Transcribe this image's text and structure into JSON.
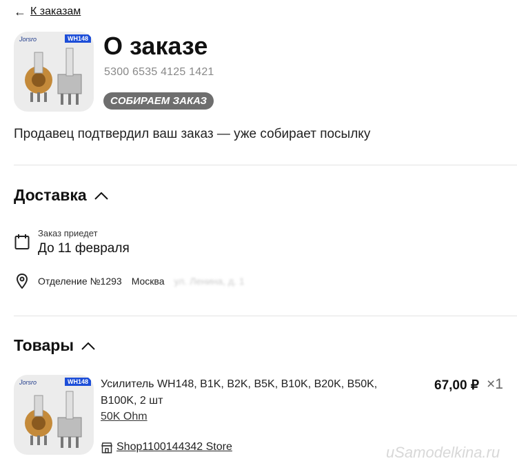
{
  "nav": {
    "back_label": "К заказам"
  },
  "order": {
    "title": "О заказе",
    "number": "5300 6535 4125 1421",
    "status_badge": "СОБИРАЕМ ЗАКАЗ",
    "status_text": "Продавец подтвердил ваш заказ — уже собирает посылку",
    "thumb_brand": "Jorsro",
    "thumb_tag": "WH148"
  },
  "delivery": {
    "title": "Доставка",
    "arrive_label": "Заказ приедет",
    "arrive_date": "До 11 февраля",
    "pickup_point": "Отделение №1293",
    "pickup_city": "Москва",
    "pickup_address_blurred": "ул. Ленина, д. 1"
  },
  "products": {
    "title": "Товары",
    "items": [
      {
        "name": "Усилитель WH148, B1K, B2K, B5K, B10K, B20K, B50K, B100K, 2 шт",
        "variant": "50K Ohm",
        "price": "67,00 ₽",
        "qty": "×1",
        "store": "Shop1100144342 Store",
        "thumb_brand": "Jorsro",
        "thumb_tag": "WH148"
      }
    ]
  },
  "watermark": "uSamodelkina.ru",
  "icons": {
    "back": "arrow-left-icon",
    "collapse": "chevron-up-icon",
    "calendar": "calendar-icon",
    "pin": "location-pin-icon",
    "store": "store-icon"
  }
}
